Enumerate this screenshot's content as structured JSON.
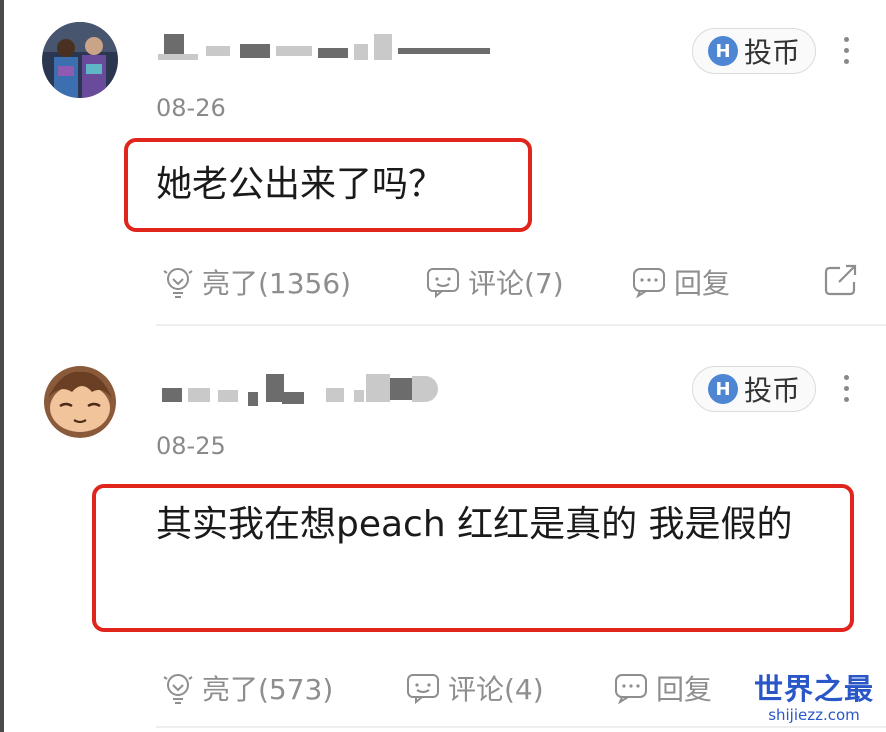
{
  "comments": [
    {
      "date": "08-26",
      "coin_label": "投币",
      "text": "她老公出来了吗？",
      "like_label": "亮了(1356)",
      "comment_label": "评论(7)",
      "reply_label": "回复"
    },
    {
      "date": "08-25",
      "coin_label": "投币",
      "text": "其实我在想peach 红红是真的 我是假的",
      "like_label": "亮了(573)",
      "comment_label": "评论(4)",
      "reply_label": "回复"
    }
  ],
  "coin_icon_letter": "H",
  "watermark": {
    "main": "世界之最",
    "sub": "shijiezz.com"
  },
  "colors": {
    "highlight": "#e0261c",
    "coin": "#4f86d4",
    "watermark": "#2a57c8"
  },
  "icons": [
    "lightbulb-icon",
    "comment-icon",
    "reply-icon",
    "share-icon",
    "more-icon",
    "coin-icon"
  ]
}
